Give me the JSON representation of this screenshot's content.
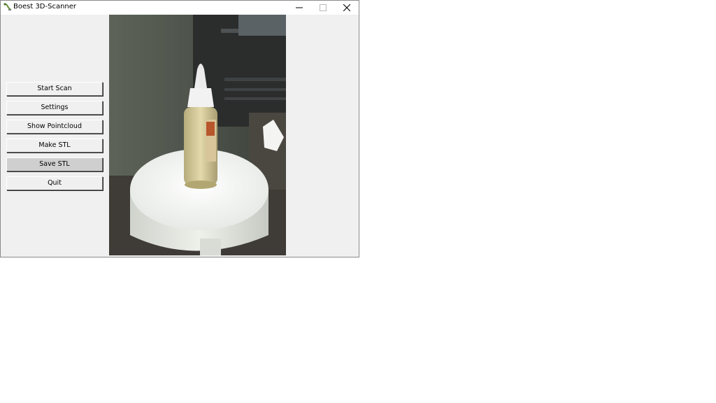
{
  "window": {
    "title": "Boest 3D-Scanner"
  },
  "titlebar": {
    "icons": [
      "app-icon",
      "minimize-icon",
      "maximize-icon",
      "close-icon"
    ]
  },
  "sidebar": {
    "buttons": [
      {
        "label": "Start Scan"
      },
      {
        "label": "Settings"
      },
      {
        "label": "Show Pointcloud"
      },
      {
        "label": "Make STL"
      },
      {
        "label": "Save STL"
      },
      {
        "label": "Quit"
      }
    ]
  },
  "camera": {
    "feed": "camera-feed"
  },
  "colors": {
    "window_bg": "#f0f0f0",
    "titlebar_bg": "#ffffff",
    "pressed_button_bg": "#cfcfcf"
  }
}
